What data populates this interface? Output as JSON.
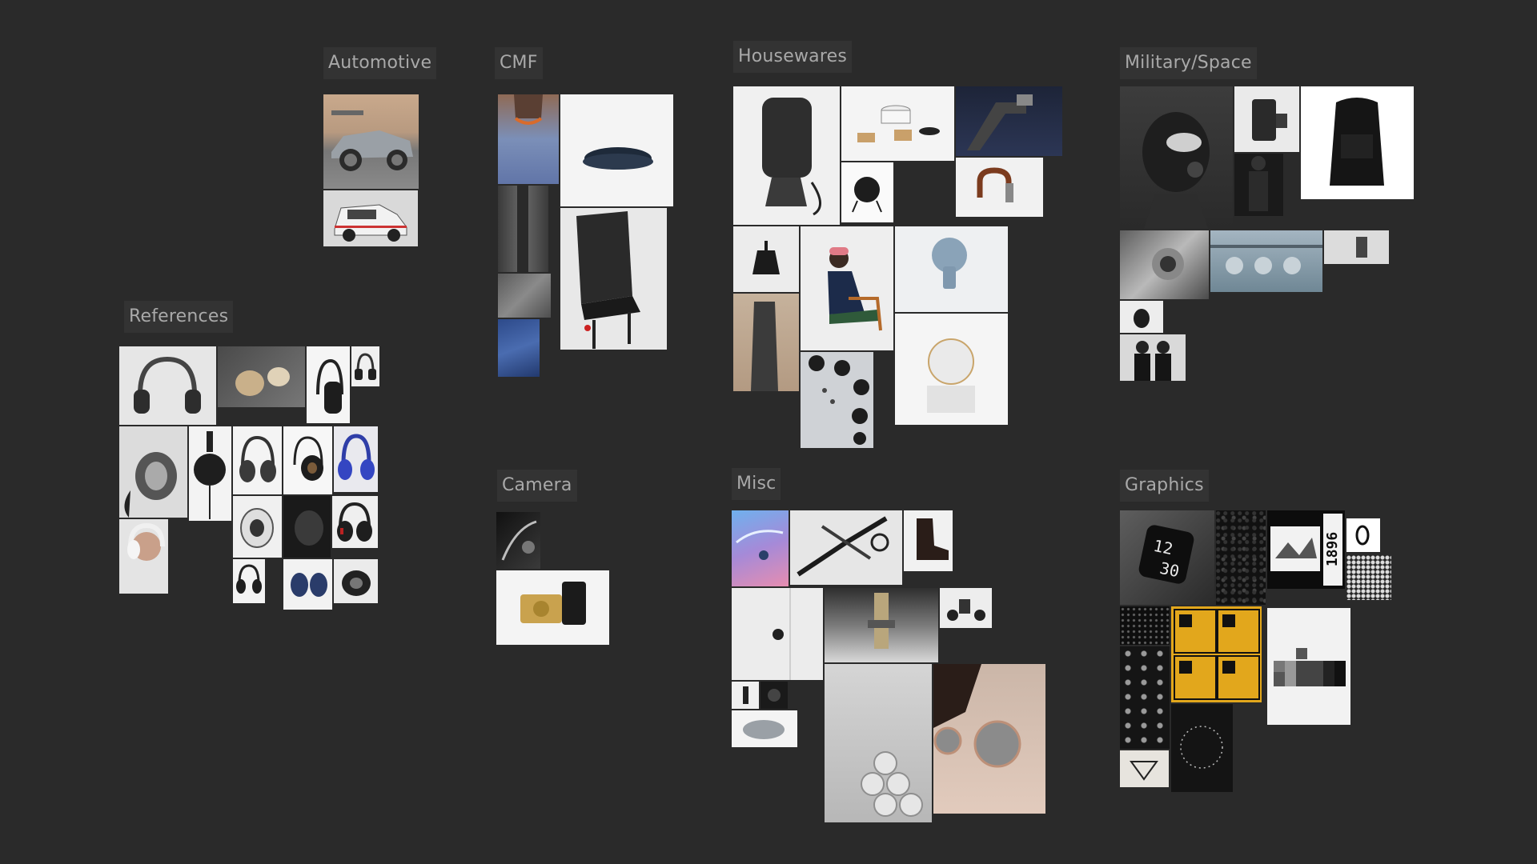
{
  "board": {
    "background": "#2a2a2a",
    "label_background": "#333333",
    "label_color": "#a9a9a9"
  },
  "groups": {
    "automotive": {
      "label": "Automotive"
    },
    "cmf": {
      "label": "CMF"
    },
    "housewares": {
      "label": "Housewares"
    },
    "military_space": {
      "label": "Military/Space"
    },
    "references": {
      "label": "References"
    },
    "camera": {
      "label": "Camera"
    },
    "misc": {
      "label": "Misc"
    },
    "graphics": {
      "label": "Graphics"
    }
  },
  "graphics_text": {
    "watch_time_top": "12",
    "watch_time_bottom": "30",
    "poster_year": "1896"
  },
  "image_icons": [
    "car-icon",
    "headphones-icon",
    "sneaker-icon",
    "chair-icon",
    "speaker-icon",
    "bowl-icon",
    "umbrella-handle-icon",
    "lamp-icon",
    "person-icon",
    "mirror-icon",
    "stovetop-icon",
    "helmet-icon",
    "backpack-icon",
    "engine-icon",
    "camera-icon",
    "bicycle-icon",
    "boot-icon",
    "sunglasses-icon",
    "mouse-icon",
    "watch-icon",
    "poster-icon"
  ]
}
